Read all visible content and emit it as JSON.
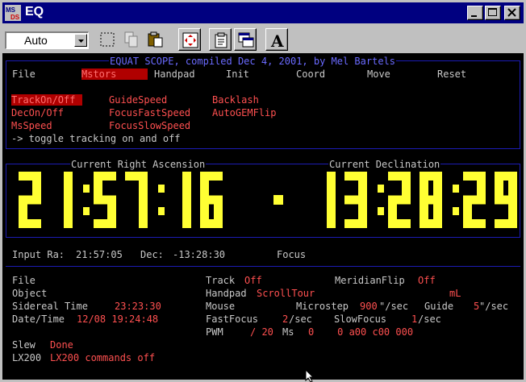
{
  "window": {
    "title": "EQ",
    "icon_text_top": "MS",
    "icon_text_bottom": "DS"
  },
  "toolbar": {
    "zoom_value": "Auto",
    "buttons": [
      "mark-icon",
      "copy-icon",
      "paste-icon",
      "fullscreen-icon",
      "properties-icon",
      "background-icon",
      "font-icon"
    ],
    "font_label": "A"
  },
  "console": {
    "banner": "EQUAT SCOPE, compiled Dec 4, 2001, by Mel Bartels",
    "menu": [
      {
        "label": "File"
      },
      {
        "label": "Mstors",
        "selected": true
      },
      {
        "label": "Handpad"
      },
      {
        "label": "Init"
      },
      {
        "label": "Coord"
      },
      {
        "label": "Move"
      },
      {
        "label": "Reset"
      }
    ],
    "submenu": {
      "col1": [
        "TrackOn/Off",
        "DecOn/Off",
        "MsSpeed"
      ],
      "col2": [
        "GuideSpeed",
        "FocusFastSpeed",
        "FocusSlowSpeed"
      ],
      "col3": [
        "Backlash",
        "AutoGEMFlip"
      ],
      "help": "-> toggle tracking on and off"
    },
    "ra_heading": "Current Right Ascension",
    "dec_heading": "Current Declination",
    "ra_display": "21:57:16",
    "dec_display": "13:28:29",
    "input_line": {
      "ra_label": "Input Ra:",
      "ra_value": "21:57:05",
      "dec_label": "Dec:",
      "dec_value": "-13:28:30",
      "focus_label": "Focus"
    },
    "status": {
      "file_label": "File",
      "object_label": "Object",
      "sidereal_label": "Sidereal Time",
      "sidereal_value": "23:23:30",
      "datetime_label": "Date/Time",
      "datetime_value": "12/08 19:24:48",
      "slew_label": "Slew",
      "slew_value": "Done",
      "lx200_label": "LX200",
      "lx200_value": "LX200 commands off",
      "track_label": "Track",
      "track_value": "Off",
      "meridian_label": "MeridianFlip",
      "meridian_value": "Off",
      "handpad_label": "Handpad",
      "handpad_value": "ScrollTour",
      "ml_value": "mL",
      "mouse_label": "Mouse",
      "microstep_label": "Microstep",
      "microstep_value": "900",
      "microstep_unit": "\"/sec",
      "guide_label": "Guide",
      "guide_value": "5",
      "guide_unit": "\"/sec",
      "fastfocus_label": "FastFocus",
      "fastfocus_value": "2",
      "fastfocus_unit": "/sec",
      "slowfocus_label": "SlowFocus",
      "slowfocus_value": "1",
      "slowfocus_unit": "/sec",
      "pwm_label": "PWM",
      "pwm_value": "/ 20",
      "ms_label": "Ms",
      "pwm_nums": "0    0 a00 c00 000"
    },
    "colors": {
      "text": "#c8c8c8",
      "value": "#ff5050",
      "banner": "#6a6aff",
      "digits": "#ffff33",
      "frame": "#1c1cb4",
      "highlight": "#b00000"
    }
  }
}
